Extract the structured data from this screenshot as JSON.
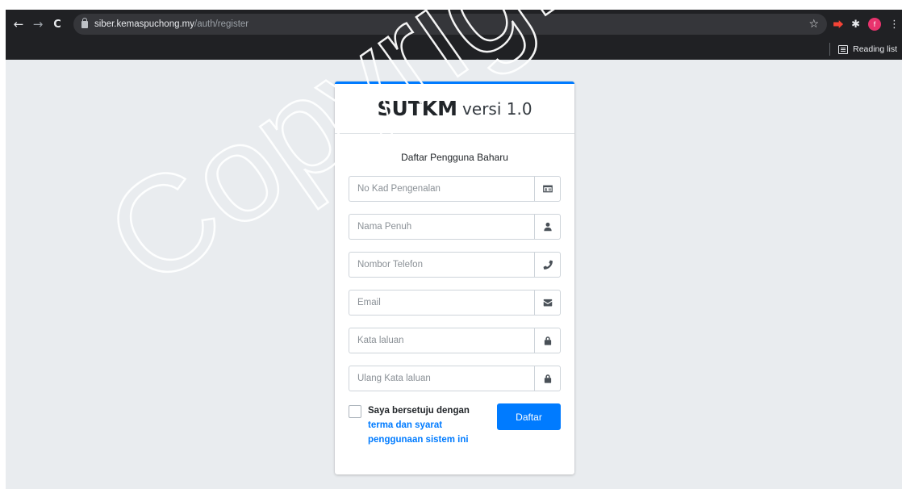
{
  "browser": {
    "url_domain": "siber.kemaspuchong.my",
    "url_path": "/auth/register",
    "profile_initial": "f",
    "reading_list_label": "Reading list",
    "icons": {
      "back": "←",
      "forward": "→",
      "reload": "C",
      "star": "☆",
      "puzzle": "✱",
      "menu": "⋮"
    }
  },
  "card": {
    "brand_bold": "SUTKM",
    "brand_light": "versi 1.0",
    "subtitle": "Daftar Pengguna Baharu"
  },
  "form": {
    "fields": [
      {
        "placeholder": "No Kad Pengenalan",
        "icon": "id-card-icon"
      },
      {
        "placeholder": "Nama Penuh",
        "icon": "user-icon"
      },
      {
        "placeholder": "Nombor Telefon",
        "icon": "phone-icon"
      },
      {
        "placeholder": "Email",
        "icon": "envelope-icon"
      },
      {
        "placeholder": "Kata laluan",
        "icon": "lock-icon"
      },
      {
        "placeholder": "Ulang Kata laluan",
        "icon": "lock-icon"
      }
    ],
    "agree_text": "Saya bersetuju dengan",
    "agree_link": "terma dan syarat penggunaan sistem ini",
    "submit_label": "Daftar"
  },
  "watermark": {
    "text": "Copyright"
  },
  "colors": {
    "accent": "#007bff",
    "page_bg": "#e9ecef",
    "chrome_bg": "#202124"
  }
}
